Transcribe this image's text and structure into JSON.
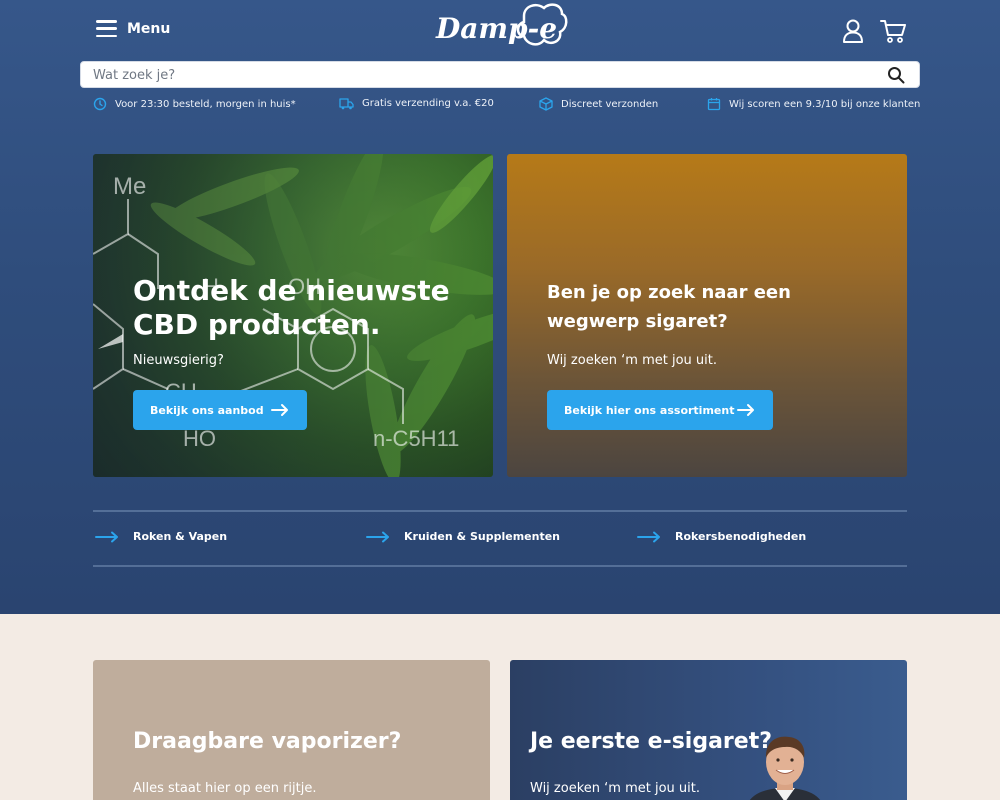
{
  "header": {
    "menu_label": "Menu",
    "logo_text": "Damp-e"
  },
  "search": {
    "placeholder": "Wat zoek je?"
  },
  "usps": [
    {
      "icon": "clock-icon",
      "text": "Voor 23:30 besteld, morgen in huis*"
    },
    {
      "icon": "truck-icon",
      "text": "Gratis verzending v.a. €20"
    },
    {
      "icon": "package-icon",
      "text": "Discreet verzonden"
    },
    {
      "icon": "calendar-icon",
      "text": "Wij scoren een 9.3/10 bij onze klanten"
    }
  ],
  "hero": {
    "cbd": {
      "title_line1": "Ontdek de nieuwste",
      "title_line2": "CBD producten.",
      "subtitle": "Nieuwsgierig?",
      "button": "Bekijk ons aanbod",
      "image_labels": {
        "me": "Me",
        "oh": "OH",
        "ch": "CH",
        "ho": "HO",
        "h": "H",
        "pentyl": "n-C5H11"
      }
    },
    "wegwerp": {
      "title_line1": "Ben je op zoek naar een",
      "title_line2": "wegwerp sigaret?",
      "subtitle": "Wij zoeken ‘m met jou uit.",
      "button": "Bekijk hier ons assortiment"
    }
  },
  "categories": [
    {
      "label": "Roken & Vapen"
    },
    {
      "label": "Kruiden & Supplementen"
    },
    {
      "label": "Rokersbenodigheden"
    }
  ],
  "promos": {
    "vaporizer": {
      "title": "Draagbare vaporizer?",
      "subtitle": "Alles staat hier op een rijtje."
    },
    "esigaret": {
      "title": "Je eerste e-sigaret?",
      "subtitle": "Wij zoeken ‘m met jou uit."
    }
  },
  "colors": {
    "hero_background": "#34558a",
    "accent_button": "#2ba4ec",
    "page_background": "#f3ebe4",
    "vaporizer_card": "#bfad9c",
    "wegwerp_card_top": "#b67a18"
  }
}
